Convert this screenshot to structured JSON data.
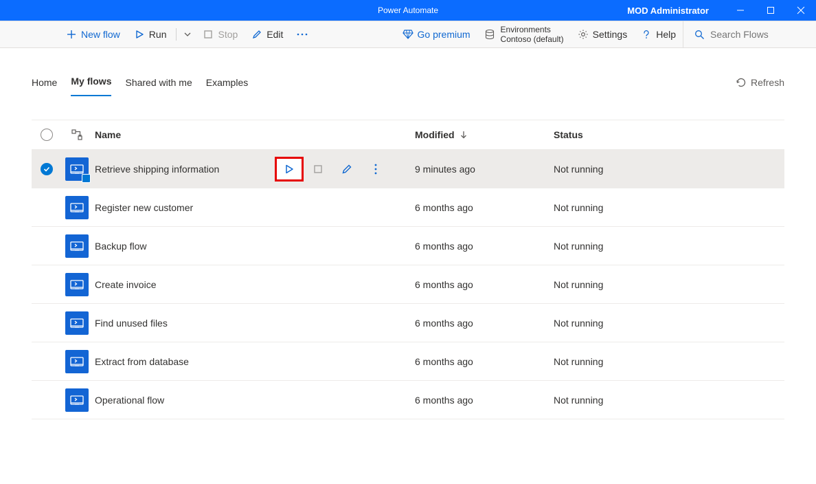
{
  "titlebar": {
    "app_title": "Power Automate",
    "user": "MOD Administrator"
  },
  "toolbar": {
    "new_flow": "New flow",
    "run": "Run",
    "stop": "Stop",
    "edit": "Edit",
    "go_premium": "Go premium",
    "env_label": "Environments",
    "env_value": "Contoso (default)",
    "settings": "Settings",
    "help": "Help",
    "search_placeholder": "Search Flows"
  },
  "tabs": {
    "home": "Home",
    "my_flows": "My flows",
    "shared": "Shared with me",
    "examples": "Examples",
    "refresh": "Refresh"
  },
  "columns": {
    "name": "Name",
    "modified": "Modified",
    "status": "Status"
  },
  "flows": [
    {
      "name": "Retrieve shipping information",
      "modified": "9 minutes ago",
      "status": "Not running",
      "selected": true,
      "badged": true,
      "show_actions": true
    },
    {
      "name": "Register new customer",
      "modified": "6 months ago",
      "status": "Not running",
      "selected": false,
      "badged": false,
      "show_actions": false
    },
    {
      "name": "Backup flow",
      "modified": "6 months ago",
      "status": "Not running",
      "selected": false,
      "badged": false,
      "show_actions": false
    },
    {
      "name": "Create invoice",
      "modified": "6 months ago",
      "status": "Not running",
      "selected": false,
      "badged": false,
      "show_actions": false
    },
    {
      "name": "Find unused files",
      "modified": "6 months ago",
      "status": "Not running",
      "selected": false,
      "badged": false,
      "show_actions": false
    },
    {
      "name": "Extract from database",
      "modified": "6 months ago",
      "status": "Not running",
      "selected": false,
      "badged": false,
      "show_actions": false
    },
    {
      "name": "Operational flow",
      "modified": "6 months ago",
      "status": "Not running",
      "selected": false,
      "badged": false,
      "show_actions": false
    }
  ]
}
